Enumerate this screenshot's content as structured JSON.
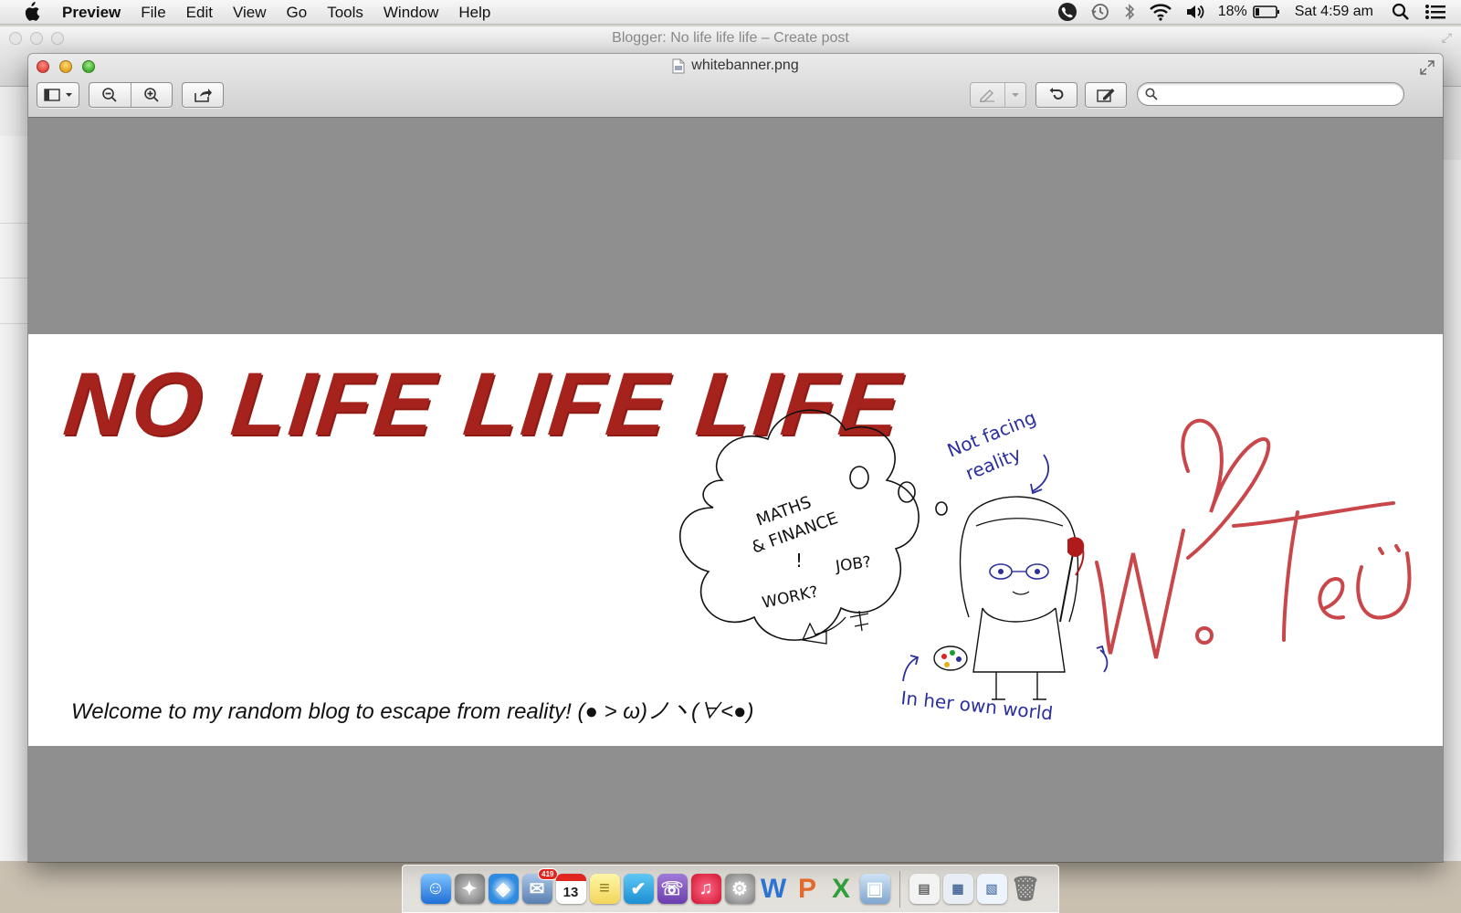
{
  "menubar": {
    "app_name": "Preview",
    "items": [
      "File",
      "Edit",
      "View",
      "Go",
      "Tools",
      "Window",
      "Help"
    ],
    "battery_percent": "18%",
    "clock": "Sat 4:59 am"
  },
  "background_window": {
    "title": "Blogger: No life life life – Create post"
  },
  "preview_window": {
    "title": "whitebanner.png",
    "search": {
      "placeholder": "",
      "value": ""
    }
  },
  "banner": {
    "title": "NO LIFE LIFE LIFE",
    "tagline": "Welcome to my random blog to escape from reality! (● ˃ ω)ノ丶(∀<●)",
    "signature": "W. Teo",
    "sketch_notes": {
      "not_facing": "Not facing",
      "reality": "reality",
      "maths": "MATHS",
      "finance": "& FINANCE",
      "job": "JOB?",
      "work": "WORK?",
      "in_her_own_world": "In her own world"
    }
  },
  "dock": {
    "calendar_day": "13",
    "mail_badge": "419"
  },
  "colors": {
    "banner_red": "#a5231c",
    "signature_red": "#c9474a",
    "ink_blue": "#2b2f9e",
    "canvas_gray": "#8f8f8f"
  }
}
